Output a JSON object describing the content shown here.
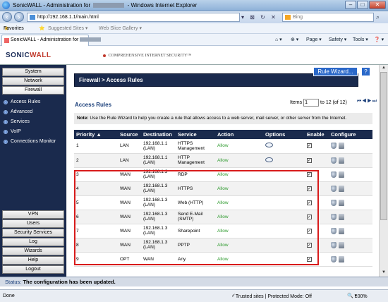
{
  "window": {
    "title_prefix": "SonicWALL - Administration for",
    "title_suffix": "- Windows Internet Explorer",
    "min": "–",
    "max": "□",
    "close": "✕"
  },
  "address": {
    "url": "http://192.168.1.1/main.html",
    "tools": "▾ ⊠ ↻ ✕",
    "search_placeholder": "Bing",
    "search_go": "⌕"
  },
  "favorites": {
    "label": "Favorites",
    "suggested": "Suggested Sites ▾",
    "web_slice": "Web Slice Gallery ▾"
  },
  "tab": {
    "label": "SonicWALL - Administration for"
  },
  "toolbar": {
    "page": "Page ▾",
    "safety": "Safety ▾",
    "tools": "Tools ▾",
    "help": "❓ ▾"
  },
  "header": {
    "logo_main": "SONIC",
    "logo_rest": "WALL",
    "tagline": "COMPREHENSIVE INTERNET SECURITY™"
  },
  "sidebar": {
    "top": [
      "System",
      "Network",
      "Firewall"
    ],
    "items": [
      "Access Rules",
      "Advanced",
      "Services",
      "VoIP",
      "Connections Monitor"
    ],
    "bottom": [
      "VPN",
      "Users",
      "Security Services",
      "Log",
      "Wizards",
      "Help",
      "Logout"
    ]
  },
  "page": {
    "breadcrumb": "Firewall > Access Rules",
    "wizard_button": "Rule Wizard...",
    "help_button": "?",
    "section_title": "Access Rules",
    "items_label": "Items",
    "items_value": "1",
    "items_range": "to 12 (of 12)",
    "pager": "⏮◀▶⏭",
    "note_bold": "Note:",
    "note_text": " Use the Rule Wizard to help you create a rule that allows access to a web server, mail server, or other server from the Internet."
  },
  "table": {
    "headers": [
      "Priority ▲",
      "Source",
      "Destination",
      "Service",
      "Action",
      "Options",
      "Enable",
      "Configure"
    ],
    "rows": [
      {
        "priority": "1",
        "source": "LAN",
        "dest": "192.168.1.1 (LAN)",
        "service": "HTTPS Management",
        "action": "Allow",
        "comment": true,
        "enable": "✓"
      },
      {
        "priority": "2",
        "source": "LAN",
        "dest": "192.168.1.1 (LAN)",
        "service": "HTTP Management",
        "action": "Allow",
        "comment": true,
        "enable": "✓"
      },
      {
        "priority": "3",
        "source": "WAN",
        "dest": "192.168.1.3 (LAN)",
        "service": "RDP",
        "action": "Allow",
        "comment": false,
        "enable": "✓"
      },
      {
        "priority": "4",
        "source": "WAN",
        "dest": "192.168.1.3 (LAN)",
        "service": "HTTPS",
        "action": "Allow",
        "comment": false,
        "enable": "✓"
      },
      {
        "priority": "5",
        "source": "WAN",
        "dest": "192.168.1.3 (LAN)",
        "service": "Web (HTTP)",
        "action": "Allow",
        "comment": false,
        "enable": "✓"
      },
      {
        "priority": "6",
        "source": "WAN",
        "dest": "192.168.1.3 (LAN)",
        "service": "Send E-Mail (SMTP)",
        "action": "Allow",
        "comment": false,
        "enable": "✓"
      },
      {
        "priority": "7",
        "source": "WAN",
        "dest": "192.168.1.3 (LAN)",
        "service": "Sharepoint",
        "action": "Allow",
        "comment": false,
        "enable": "✓"
      },
      {
        "priority": "8",
        "source": "WAN",
        "dest": "192.168.1.3 (LAN)",
        "service": "PPTP",
        "action": "Allow",
        "comment": false,
        "enable": "✓"
      },
      {
        "priority": "9",
        "source": "OPT",
        "dest": "WAN",
        "service": "Any",
        "action": "Allow",
        "comment": false,
        "enable": "✓"
      }
    ]
  },
  "status": {
    "label": "Status:",
    "text": "The configuration has been updated."
  },
  "ie_status": {
    "left": "Done",
    "zone": "Trusted sites | Protected Mode: Off",
    "zoom": "100%"
  }
}
